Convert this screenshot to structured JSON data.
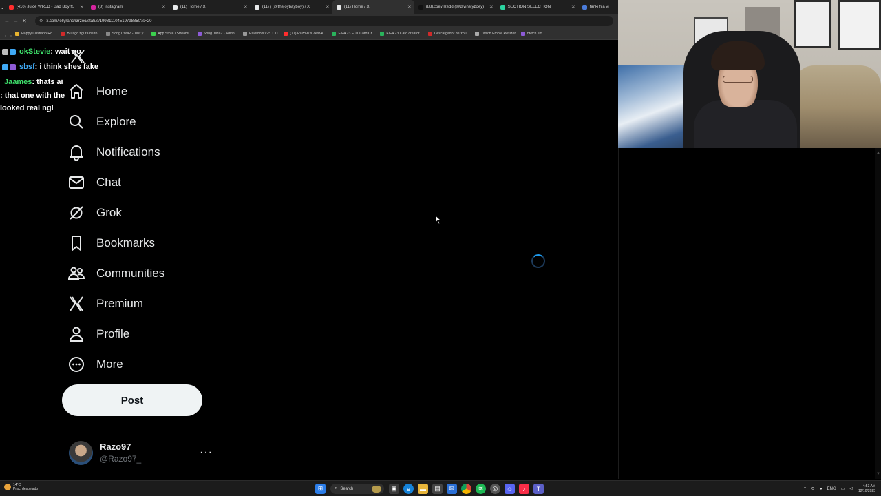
{
  "browser": {
    "tabs": [
      {
        "title": "(410) Juice WRLD - Bad Boy ft.",
        "fav_color": "#ff2d2d"
      },
      {
        "title": "(8) Instagram",
        "fav_color": "#d6249f"
      },
      {
        "title": "(11) Home / X",
        "fav_color": "#e7e9ea"
      },
      {
        "title": "(11) j (@thejoybayboy) / X",
        "fav_color": "#e7e9ea"
      },
      {
        "title": "(11) Home / X",
        "fav_color": "#e7e9ea",
        "active": true
      },
      {
        "title": "(88)Zoey Redd (@divinelyzoey)",
        "fav_color": "#111"
      },
      {
        "title": "SECTION SELECTION",
        "fav_color": "#2bd4a0"
      },
      {
        "title": "fanki fila vi",
        "fav_color": "#4a7bd9"
      }
    ],
    "url": "x.com/lollyranch3rzoo/status/199811104519798850?s=20",
    "bookmarks": [
      {
        "label": "Happy Cristiano Ro...",
        "fav_color": "#e7b32f"
      },
      {
        "label": "Burago figura de to...",
        "fav_color": "#d12a2a"
      },
      {
        "label": "SongTrivia2 - Test y...",
        "fav_color": "#888"
      },
      {
        "label": "App Store / Streami...",
        "fav_color": "#3ccf4e"
      },
      {
        "label": "SongTrivia2 - Advin...",
        "fav_color": "#8d5bd6"
      },
      {
        "label": "Paletools v25.1.11",
        "fav_color": "#999"
      },
      {
        "label": "(77) Razo97's Zest-A...",
        "fav_color": "#ff2d2d"
      },
      {
        "label": "FIFA 23 FUT Card Cr...",
        "fav_color": "#2ab35c"
      },
      {
        "label": "FIFA 23 Card creator...",
        "fav_color": "#2ab35c"
      },
      {
        "label": "Descargador de You...",
        "fav_color": "#d12a2a"
      },
      {
        "label": "Twitch Emote Resizer",
        "fav_color": "#aaa"
      },
      {
        "label": "twitch em",
        "fav_color": "#8d5bd6"
      }
    ]
  },
  "chat": [
    {
      "user": "okStevie",
      "color": "#3ee06b",
      "text": " : wait no",
      "badges": [
        "#bbb",
        "#3fa9f5"
      ]
    },
    {
      "user": "sbsf",
      "color": "#3fa9f5",
      "text": " : i think shes fake",
      "badges": [
        "#3fa9f5",
        "#8d5bd6"
      ]
    },
    {
      "user": "Jaames",
      "color": "#3ee06b",
      "text": " : thats ai",
      "badges": []
    },
    {
      "user": "",
      "color": "#fff",
      "text": ": that one with the",
      "badges": []
    },
    {
      "user": "",
      "color": "#fff",
      "text": "looked real ngl",
      "badges": []
    }
  ],
  "sidebar": {
    "items": [
      {
        "label": "Home",
        "icon": "home-icon"
      },
      {
        "label": "Explore",
        "icon": "search-icon"
      },
      {
        "label": "Notifications",
        "icon": "bell-icon"
      },
      {
        "label": "Chat",
        "icon": "mail-icon"
      },
      {
        "label": "Grok",
        "icon": "grok-icon"
      },
      {
        "label": "Bookmarks",
        "icon": "bookmark-icon"
      },
      {
        "label": "Communities",
        "icon": "people-icon"
      },
      {
        "label": "Premium",
        "icon": "x-logo-icon"
      },
      {
        "label": "Profile",
        "icon": "person-icon"
      },
      {
        "label": "More",
        "icon": "more-circle-icon"
      }
    ],
    "post_label": "Post"
  },
  "account": {
    "name": "Razo97",
    "handle": "@Razo97_",
    "more": "···"
  },
  "taskbar": {
    "weather_temp": "14°C",
    "weather_desc": "Prac. despejado",
    "search_label": "Search",
    "lang": "ENG",
    "time": "4:53 AM",
    "date": "12/10/2025"
  },
  "colors": {
    "accent": "#1d9bf0",
    "background": "#000000",
    "text": "#e7e9ea",
    "muted": "#71767b"
  }
}
